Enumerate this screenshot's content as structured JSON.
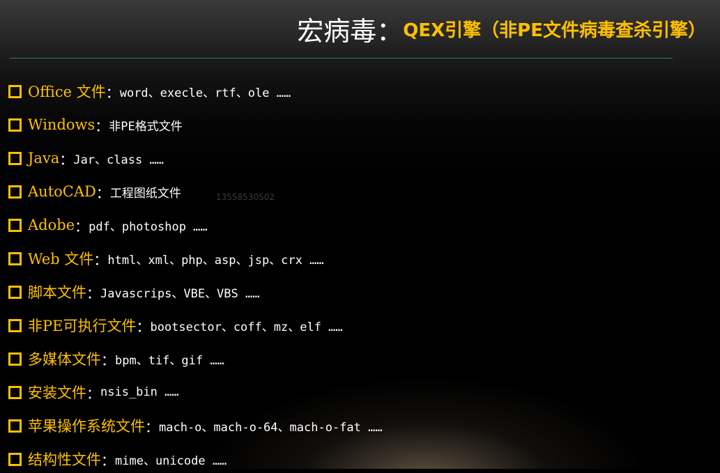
{
  "slide": {
    "title_main": "宏病毒：",
    "title_sub": "QEX引擎（非PE文件病毒查杀引擎）",
    "watermark": "13558530502"
  },
  "items": [
    {
      "label": "Office 文件",
      "sep": "：",
      "value": "word、execle、rtf、ole ……"
    },
    {
      "label": "Windows ",
      "sep": "：",
      "value": "非PE格式文件"
    },
    {
      "label": "Java ",
      "sep": "：",
      "value": "Jar、class ……"
    },
    {
      "label": "AutoCAD",
      "sep": "：",
      "value": "工程图纸文件"
    },
    {
      "label": "Adobe ",
      "sep": "：",
      "value": "pdf、photoshop ……"
    },
    {
      "label": "Web 文件",
      "sep": "：",
      "value": "html、xml、php、asp、jsp、crx ……"
    },
    {
      "label": "脚本文件",
      "sep": "：",
      "value": "Javascrips、VBE、VBS ……"
    },
    {
      "label": "非PE可执行文件",
      "sep": "：",
      "value": "bootsector、coff、mz、elf ……"
    },
    {
      "label": "多媒体文件",
      "sep": "：",
      "value": "bpm、tif、gif ……"
    },
    {
      "label": "安装文件",
      "sep": "：",
      "value": "nsis_bin ……"
    },
    {
      "label": "苹果操作系统文件",
      "sep": "：",
      "value": "mach-o、mach-o-64、mach-o-fat ……"
    },
    {
      "label": "结构性文件",
      "sep": "：",
      "value": "mime、unicode ……"
    }
  ],
  "colors": {
    "accent": "#ffc000",
    "text": "#ffffff",
    "rule": "#2e7d57",
    "background": "#000000"
  }
}
